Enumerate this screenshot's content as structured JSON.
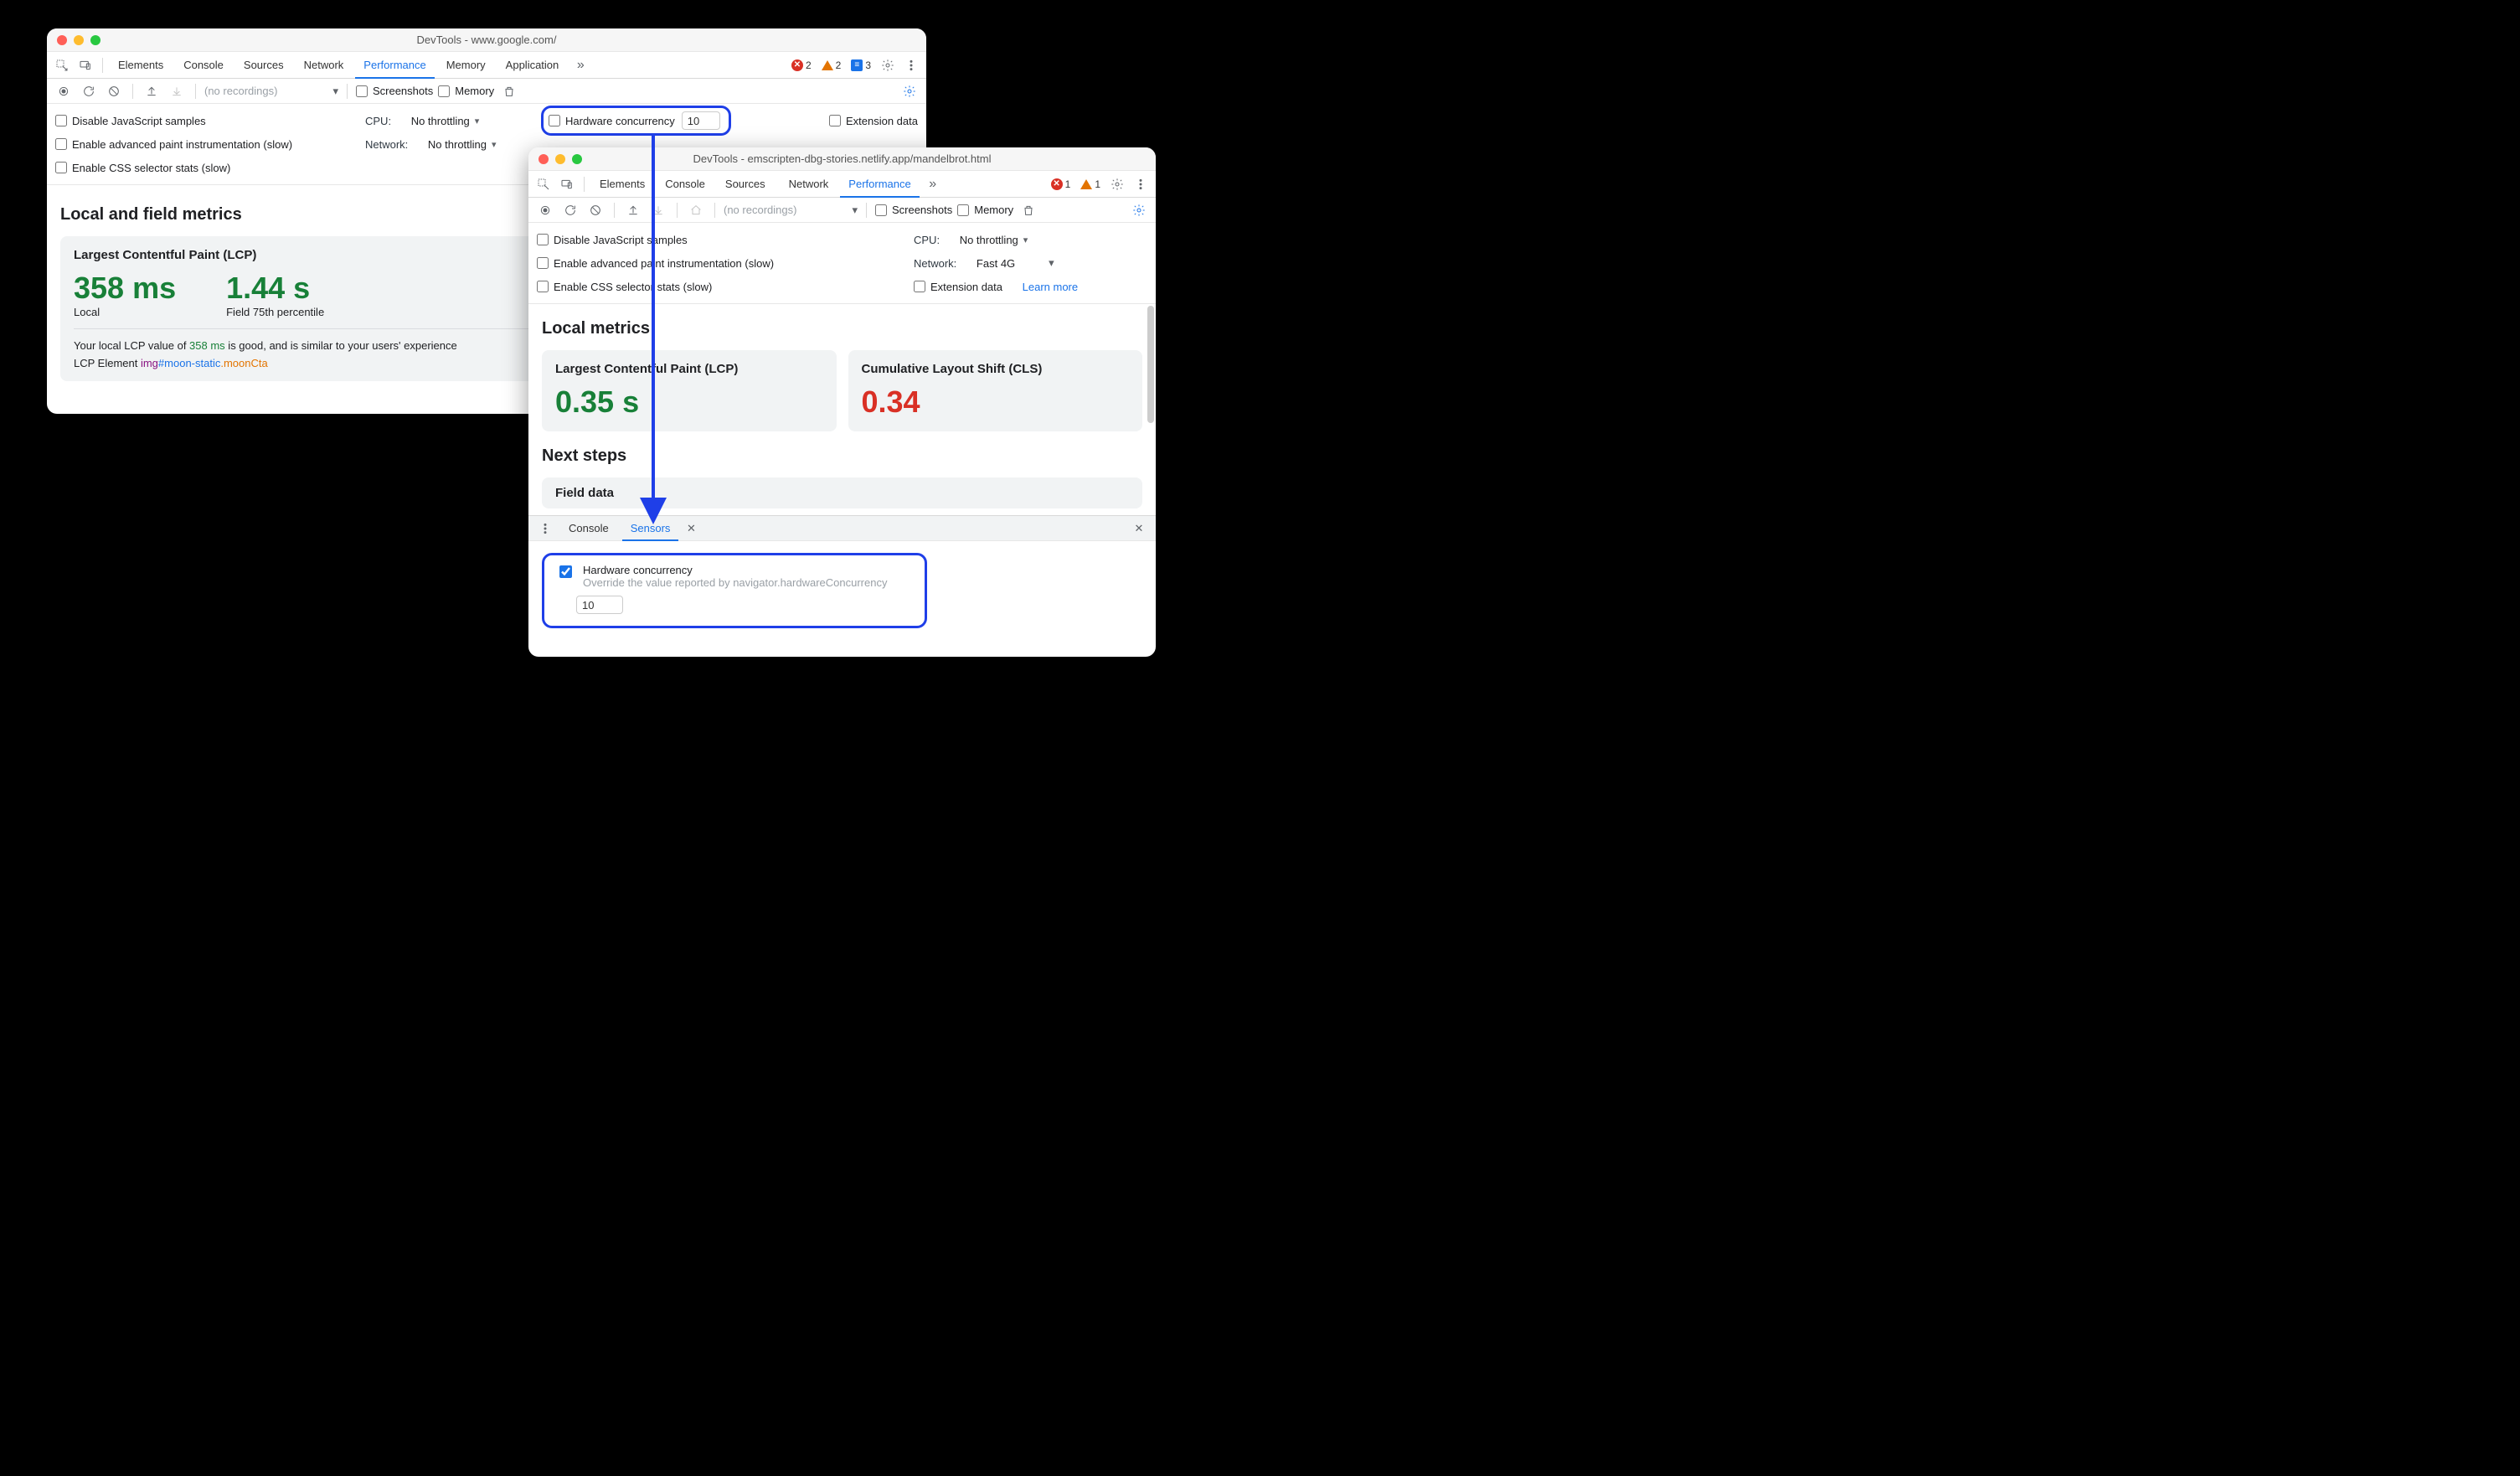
{
  "win1": {
    "title": "DevTools - www.google.com/",
    "tabs": [
      "Elements",
      "Console",
      "Sources",
      "Network",
      "Performance",
      "Memory",
      "Application"
    ],
    "tabs_active": "Performance",
    "counts": {
      "errors": "2",
      "warnings": "2",
      "messages": "3"
    },
    "toolbar": {
      "recordings": "(no recordings)",
      "screenshots": "Screenshots",
      "memory": "Memory"
    },
    "options": {
      "disable_js": "Disable JavaScript samples",
      "cpu_label": "CPU:",
      "cpu_value": "No throttling",
      "hw_label": "Hardware concurrency",
      "hw_value": "10",
      "ext_data": "Extension data",
      "adv_paint": "Enable advanced paint instrumentation (slow)",
      "net_label": "Network:",
      "net_value": "No throttling",
      "css_stats": "Enable CSS selector stats (slow)"
    },
    "metrics": {
      "heading": "Local and field metrics",
      "lcp_title": "Largest Contentful Paint (LCP)",
      "lcp_local_value": "358 ms",
      "lcp_local_label": "Local",
      "lcp_field_value": "1.44 s",
      "lcp_field_label": "Field 75th percentile",
      "desc_pre": "Your local LCP value of ",
      "desc_val": "358 ms",
      "desc_post": " is good, and is similar to your users' experience",
      "elem_label": "LCP Element ",
      "elem_tag": "img",
      "elem_id": "#moon-static",
      "elem_class": ".moonCta"
    }
  },
  "win2": {
    "title": "DevTools - emscripten-dbg-stories.netlify.app/mandelbrot.html",
    "tabs": [
      "Elements",
      "Console",
      "Sources",
      "Network",
      "Performance"
    ],
    "tabs_active": "Performance",
    "net_warn": true,
    "counts": {
      "errors": "1",
      "warnings": "1"
    },
    "toolbar": {
      "recordings": "(no recordings)",
      "screenshots": "Screenshots",
      "memory": "Memory"
    },
    "options": {
      "disable_js": "Disable JavaScript samples",
      "cpu_label": "CPU:",
      "cpu_value": "No throttling",
      "adv_paint": "Enable advanced paint instrumentation (slow)",
      "net_label": "Network:",
      "net_value": "Fast 4G",
      "css_stats": "Enable CSS selector stats (slow)",
      "ext_data": "Extension data",
      "learn_more": "Learn more"
    },
    "metrics": {
      "heading": "Local metrics",
      "lcp_title": "Largest Contentful Paint (LCP)",
      "lcp_value": "0.35 s",
      "cls_title": "Cumulative Layout Shift (CLS)",
      "cls_value": "0.34",
      "next_steps": "Next steps",
      "field_data": "Field data"
    },
    "drawer": {
      "tab_console": "Console",
      "tab_sensors": "Sensors",
      "hw_label": "Hardware concurrency",
      "hw_desc": "Override the value reported by navigator.hardwareConcurrency",
      "hw_value": "10"
    }
  }
}
